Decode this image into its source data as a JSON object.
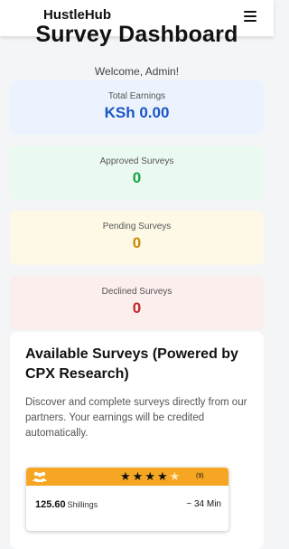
{
  "header": {
    "brand": "HustleHub",
    "menu_icon": "hamburger-menu-icon"
  },
  "page": {
    "title": "Survey Dashboard",
    "welcome": "Welcome, Admin!"
  },
  "stats": {
    "earnings": {
      "label": "Total Earnings",
      "value": "KSh 0.00",
      "color": "#1a56c4"
    },
    "approved": {
      "label": "Approved Surveys",
      "value": "0",
      "color": "#16a34a"
    },
    "pending": {
      "label": "Pending Surveys",
      "value": "0",
      "color": "#ca8a04"
    },
    "declined": {
      "label": "Declined Surveys",
      "value": "0",
      "color": "#c02626"
    }
  },
  "surveys": {
    "title": "Available Surveys (Powered by CPX Research)",
    "description": "Discover and complete surveys directly from our partners. Your earnings will be credited automatically.",
    "offer": {
      "icon": "users-icon",
      "rating": 4,
      "rating_max": 5,
      "review_count": "(9)",
      "amount": "125.60",
      "unit": "Shillings",
      "duration": "~ 34 Min",
      "accent_color": "#f6a623"
    }
  }
}
